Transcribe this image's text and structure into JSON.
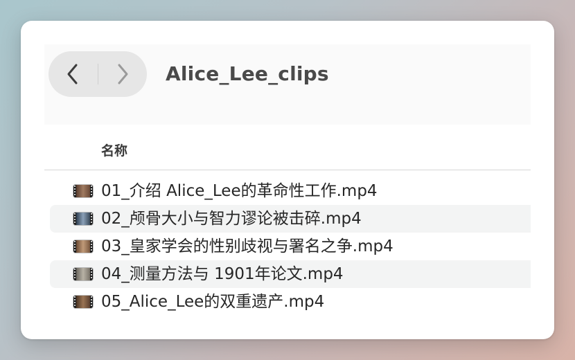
{
  "window": {
    "title": "Alice_Lee_clips",
    "nav": {
      "back_icon": "chevron-left-icon",
      "forward_icon": "chevron-right-icon"
    }
  },
  "list": {
    "column_header": "名称",
    "files": [
      {
        "name": "01_介绍 Alice_Lee的革命性工作.mp4",
        "icon": "video-file-icon",
        "thumb_color": "#7a5a48"
      },
      {
        "name": "02_颅骨大小与智力谬论被击碎.mp4",
        "icon": "video-file-icon",
        "thumb_color": "#4a5a6a"
      },
      {
        "name": "03_皇家学会的性别歧视与署名之争.mp4",
        "icon": "video-file-icon",
        "thumb_color": "#8a6850"
      },
      {
        "name": "04_测量方法与 1901年论文.mp4",
        "icon": "video-file-icon",
        "thumb_color": "#8a8478"
      },
      {
        "name": "05_Alice_Lee的双重遗产.mp4",
        "icon": "video-file-icon",
        "thumb_color": "#6a5038"
      }
    ]
  },
  "colors": {
    "row_alt": "#f3f4f4",
    "text": "#262626",
    "title": "#4a4a4a"
  }
}
